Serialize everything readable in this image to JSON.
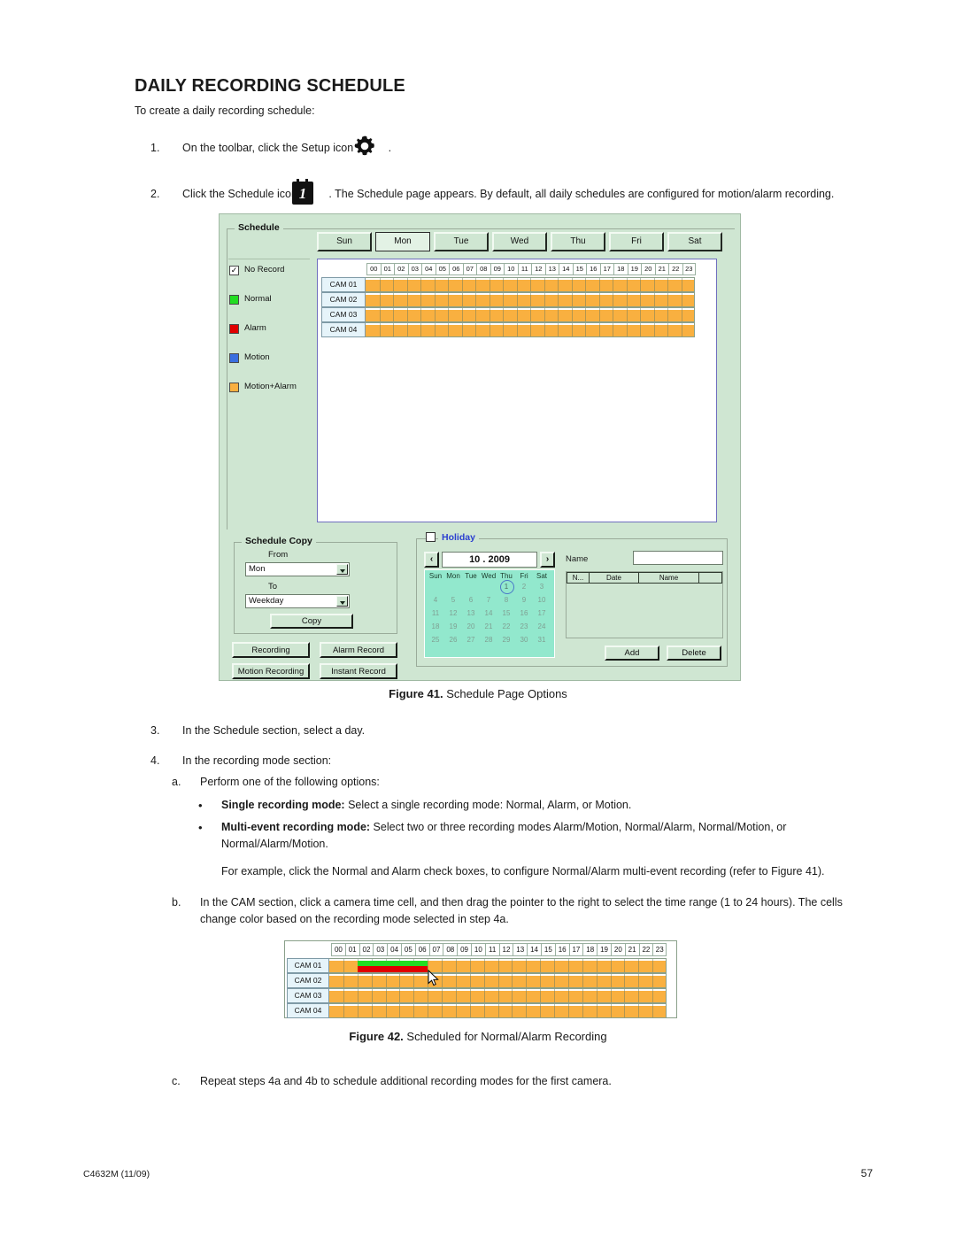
{
  "document": {
    "heading": "DAILY RECORDING SCHEDULE",
    "intro": "To create a daily recording schedule:",
    "steps": {
      "s1_num": "1.",
      "s1_pre": "On the toolbar, click the Setup icon",
      "s1_post": ".",
      "s2_num": "2.",
      "s2_pre": "Click the Schedule icon",
      "s2_post": ". The Schedule page appears. By default, all daily schedules are configured for motion/alarm recording.",
      "s3_num": "3.",
      "s3_text": "In the Schedule section, select a day.",
      "s4_num": "4.",
      "s4_text": "In the recording mode section:",
      "s4a_label": "a.",
      "s4a_text": "Perform one of the following options:",
      "bullet1_bold": "Single recording mode:",
      "bullet1_text": " Select a single recording mode: Normal, Alarm, or Motion.",
      "bullet2_bold": "Multi-event recording mode:",
      "bullet2_text": " Select two or three recording modes Alarm/Motion, Normal/Alarm, Normal/Motion, or Normal/Alarm/Motion.",
      "example_text": "For example, click the Normal and Alarm check boxes, to configure Normal/Alarm multi-event recording (refer to Figure 41).",
      "s4b_label": "b.",
      "s4b_text": "In the CAM section, click a camera time cell, and then drag the pointer to the right to select the time range (1 to 24 hours). The cells change color based on the recording mode selected in step 4a.",
      "s4c_label": "c.",
      "s4c_text": "Repeat steps 4a and 4b to schedule additional recording modes for the first camera."
    },
    "figure41": {
      "bold": "Figure 41.",
      "caption": " Schedule Page Options"
    },
    "figure42": {
      "bold": "Figure 42.",
      "caption": " Scheduled for Normal/Alarm Recording"
    },
    "footer": {
      "left": "C4632M (11/09)",
      "right": "57"
    }
  },
  "dialog": {
    "schedule_group_title": "Schedule",
    "day_tabs": [
      {
        "label": "Sun",
        "selected": false
      },
      {
        "label": "Mon",
        "selected": true
      },
      {
        "label": "Tue",
        "selected": false
      },
      {
        "label": "Wed",
        "selected": false
      },
      {
        "label": "Thu",
        "selected": false
      },
      {
        "label": "Fri",
        "selected": false
      },
      {
        "label": "Sat",
        "selected": false
      }
    ],
    "legend": [
      {
        "label": "No Record",
        "color": "#ffffff",
        "checked": true,
        "check": "✓"
      },
      {
        "label": "Normal",
        "color": "#22dd22",
        "checked": false
      },
      {
        "label": "Alarm",
        "color": "#e00000",
        "checked": false
      },
      {
        "label": "Motion",
        "color": "#3a6fe0",
        "checked": false
      },
      {
        "label": "Motion+Alarm",
        "color": "#f9b040",
        "checked": false
      }
    ],
    "hours": [
      "00",
      "01",
      "02",
      "03",
      "04",
      "05",
      "06",
      "07",
      "08",
      "09",
      "10",
      "11",
      "12",
      "13",
      "14",
      "15",
      "16",
      "17",
      "18",
      "19",
      "20",
      "21",
      "22",
      "23"
    ],
    "cameras": [
      "CAM 01",
      "CAM 02",
      "CAM 03",
      "CAM 04"
    ],
    "schedule_copy": {
      "title": "Schedule Copy",
      "from_label": "From",
      "from_value": "Mon",
      "to_label": "To",
      "to_value": "Weekday",
      "copy_button": "Copy"
    },
    "mode_buttons": [
      "Recording",
      "Alarm Record",
      "Motion Recording",
      "Instant Record"
    ],
    "holiday": {
      "title": "Holiday",
      "checked": false,
      "prev_label": "‹",
      "next_label": "›",
      "month_value": "10 . 2009",
      "weekdays": [
        "Sun",
        "Mon",
        "Tue",
        "Wed",
        "Thu",
        "Fri",
        "Sat"
      ],
      "weeks": [
        [
          "",
          "",
          "",
          "",
          "1",
          "2",
          "3"
        ],
        [
          "4",
          "5",
          "6",
          "7",
          "8",
          "9",
          "10"
        ],
        [
          "11",
          "12",
          "13",
          "14",
          "15",
          "16",
          "17"
        ],
        [
          "18",
          "19",
          "20",
          "21",
          "22",
          "23",
          "24"
        ],
        [
          "25",
          "26",
          "27",
          "28",
          "29",
          "30",
          "31"
        ]
      ],
      "selected_day": "1",
      "name_label": "Name",
      "name_value": "",
      "table_headers": [
        "N...",
        "Date",
        "Name",
        ""
      ],
      "rows": [],
      "add_button": "Add",
      "delete_button": "Delete"
    }
  },
  "figure42_grid": {
    "hours": [
      "00",
      "01",
      "02",
      "03",
      "04",
      "05",
      "06",
      "07",
      "08",
      "09",
      "10",
      "11",
      "12",
      "13",
      "14",
      "15",
      "16",
      "17",
      "18",
      "19",
      "20",
      "21",
      "22",
      "23"
    ],
    "cameras": [
      "CAM 01",
      "CAM 02",
      "CAM 03",
      "CAM 04"
    ],
    "selection": {
      "camera": "CAM 01",
      "start_hour": "02",
      "end_hour": "06",
      "modes": [
        "Normal",
        "Alarm"
      ]
    }
  },
  "colors": {
    "motion_alarm": "#f9b040",
    "normal": "#22dd22",
    "alarm": "#e00000",
    "motion": "#3a6fe0",
    "panel_bg": "#cfe6d2",
    "calendar_bg": "#92e8cd",
    "holiday_title": "#2b3fd0"
  }
}
